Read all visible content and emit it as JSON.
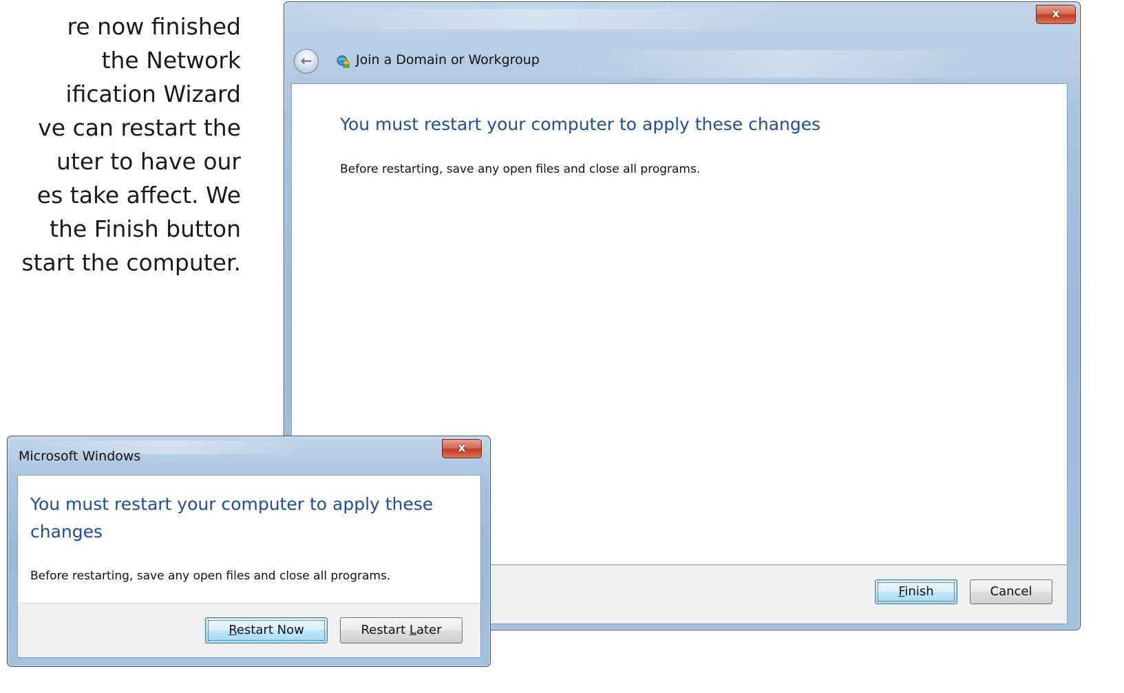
{
  "caption": {
    "lines": [
      "re now finished",
      "the Network",
      "ification Wizard",
      "ve can restart the",
      "uter to have our",
      "es take affect. We",
      " the Finish button",
      "start the computer."
    ]
  },
  "wizard": {
    "title": "Join a Domain or Workgroup",
    "close_label": "x",
    "back_icon": "back-arrow-icon",
    "heading": "You must restart your computer to apply these changes",
    "body": "Before restarting, save any open files and close all programs.",
    "finish_label_accel": "F",
    "finish_label_rest": "inish",
    "cancel_label": "Cancel"
  },
  "dialog": {
    "title": "Microsoft Windows",
    "close_label": "x",
    "heading": "You must restart your computer to apply these changes",
    "body": "Before restarting, save any open files and close all programs.",
    "restart_now_accel": "R",
    "restart_now_rest": "estart Now",
    "restart_later_pre": "Restart ",
    "restart_later_accel": "L",
    "restart_later_rest": "ater"
  },
  "colors": {
    "heading_blue": "#1e4e9a",
    "close_red": "#c23c22",
    "frame_blue": "#a9c3df"
  }
}
